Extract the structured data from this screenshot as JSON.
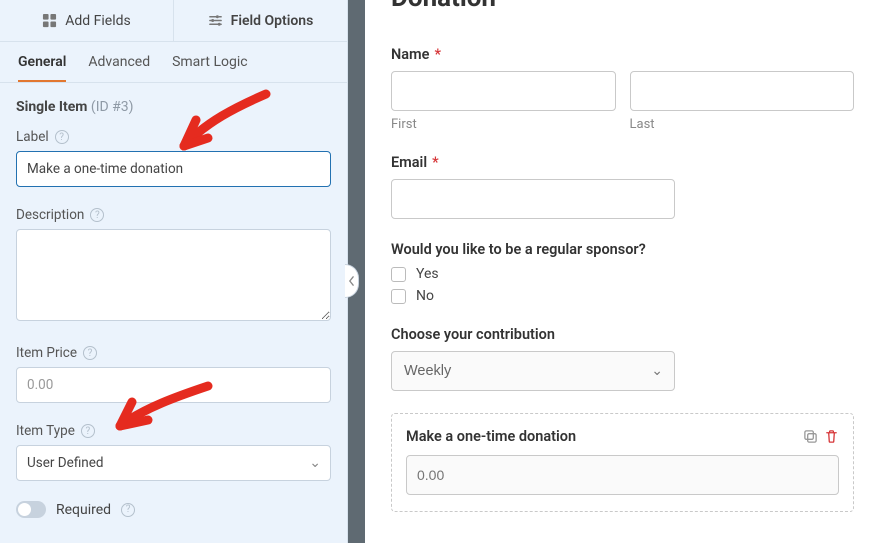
{
  "sidebar": {
    "panel_tabs": {
      "add_fields": "Add Fields",
      "field_options": "Field Options"
    },
    "sub_tabs": {
      "general": "General",
      "advanced": "Advanced",
      "smart_logic": "Smart Logic"
    },
    "field_title": "Single Item",
    "field_id": "(ID #3)",
    "labels": {
      "label": "Label",
      "description": "Description",
      "item_price": "Item Price",
      "item_type": "Item Type",
      "required": "Required"
    },
    "values": {
      "label": "Make a one-time donation",
      "description": "",
      "item_price": "0.00",
      "item_type": "User Defined"
    }
  },
  "preview": {
    "title_cut": "Donation",
    "name": {
      "label": "Name",
      "first": "First",
      "last": "Last"
    },
    "email": {
      "label": "Email"
    },
    "sponsor": {
      "label": "Would you like to be a regular sponsor?",
      "yes": "Yes",
      "no": "No"
    },
    "contribution": {
      "label": "Choose your contribution",
      "selected": "Weekly"
    },
    "single_item": {
      "label": "Make a one-time donation",
      "placeholder": "0.00"
    }
  }
}
